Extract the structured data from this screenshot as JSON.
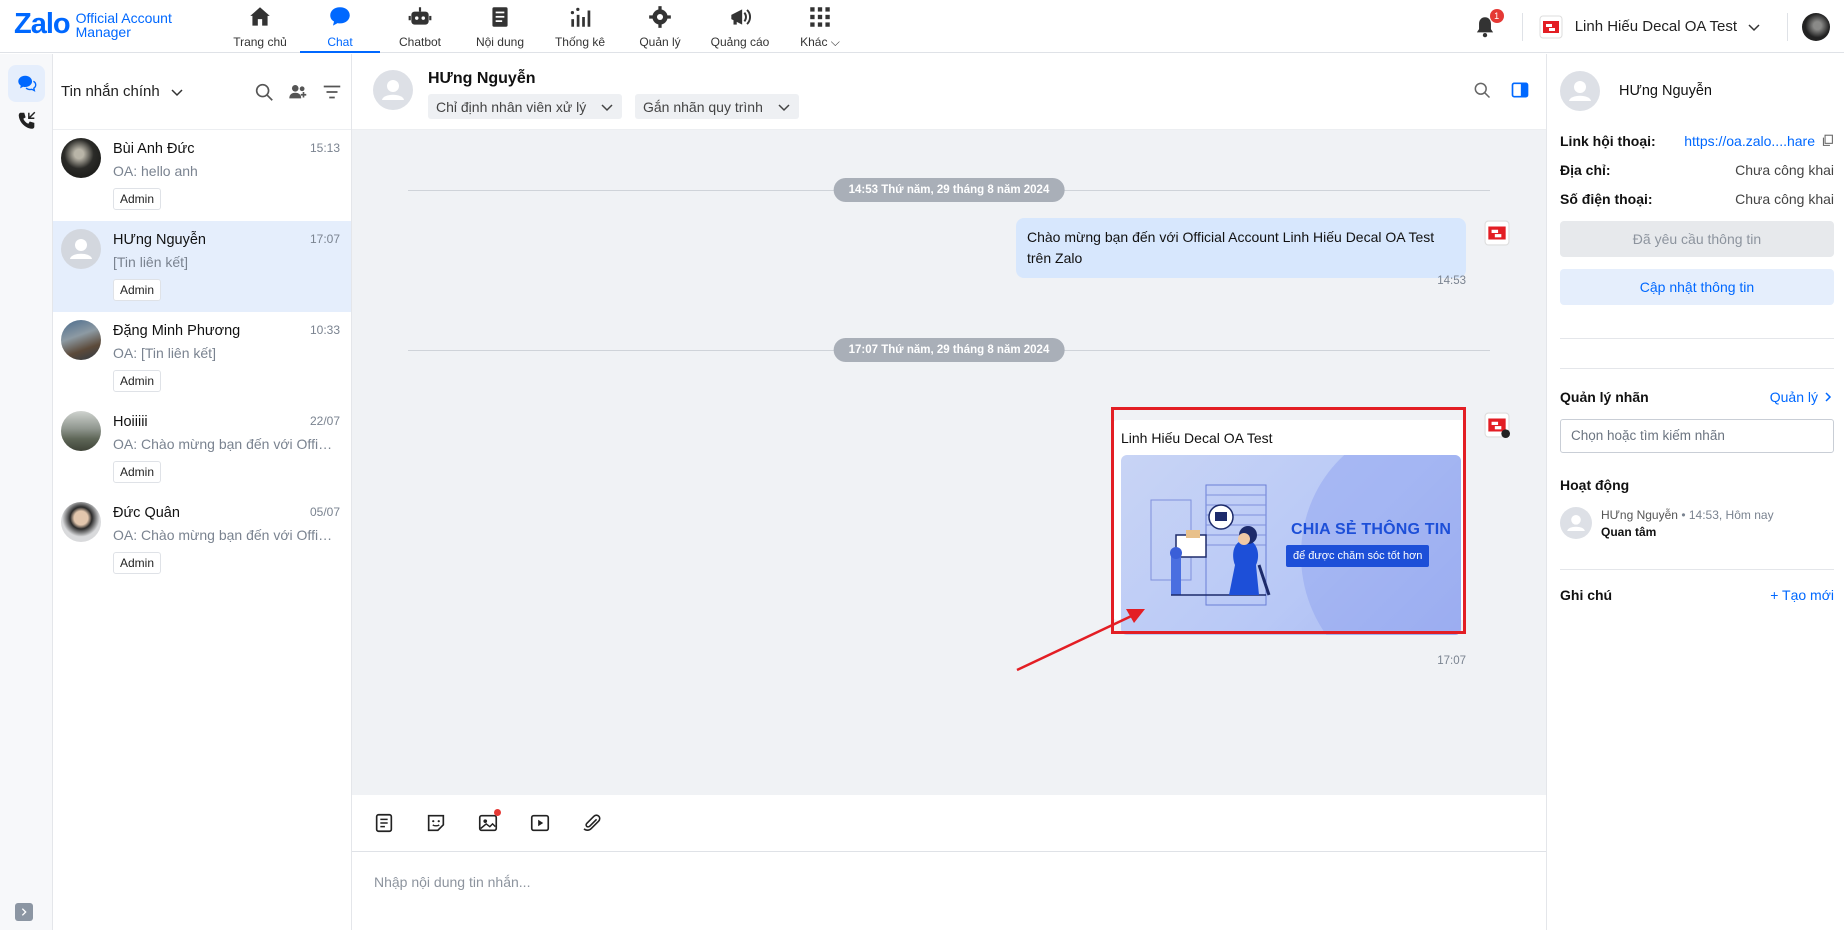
{
  "brand": {
    "logo_main": "Zalo",
    "logo_sub_line1": "Official Account",
    "logo_sub_line2": "Manager",
    "accent": "#0068ff"
  },
  "nav": {
    "items": [
      {
        "label": "Trang chủ",
        "icon": "home-icon"
      },
      {
        "label": "Chat",
        "icon": "chat-icon"
      },
      {
        "label": "Chatbot",
        "icon": "robot-icon"
      },
      {
        "label": "Nội dung",
        "icon": "document-icon"
      },
      {
        "label": "Thống kê",
        "icon": "bar-chart-icon"
      },
      {
        "label": "Quản lý",
        "icon": "gear-icon"
      },
      {
        "label": "Quảng cáo",
        "icon": "megaphone-icon"
      },
      {
        "label": "Khác",
        "icon": "grid-icon"
      }
    ],
    "active": "Chat"
  },
  "header": {
    "notification_count": "1",
    "oa_name": "Linh Hiếu Decal OA Test"
  },
  "conversation_list": {
    "filter_label": "Tin nhắn chính",
    "items": [
      {
        "name": "Bùi Anh Đức",
        "time": "15:13",
        "last": "OA: hello anh",
        "tag": "Admin"
      },
      {
        "name": "HƯng Nguyễn",
        "time": "17:07",
        "last": "[Tin liên kết]",
        "tag": "Admin"
      },
      {
        "name": "Đặng Minh Phương",
        "time": "10:33",
        "last": "OA: [Tin liên kết]",
        "tag": "Admin"
      },
      {
        "name": "Hoiiiii",
        "time": "22/07",
        "last": "OA: Chào mừng bạn đến với Official Account",
        "tag": "Admin"
      },
      {
        "name": "Đức Quân",
        "time": "05/07",
        "last": "OA: Chào mừng bạn đến với Official Account",
        "tag": "Admin"
      }
    ]
  },
  "chat": {
    "contact_name": "HƯng Nguyễn",
    "assign_label": "Chỉ định nhân viên xử lý",
    "tag_label": "Gắn nhãn quy trình",
    "date1": "14:53 Thứ năm, 29 tháng 8 năm 2024",
    "msg1_text": "Chào mừng bạn đến với Official Account Linh Hiếu Decal OA Test trên Zalo",
    "msg1_time": "14:53",
    "date2": "17:07 Thứ năm, 29 tháng 8 năm 2024",
    "card_title": "Linh Hiếu Decal OA Test",
    "card_headline": "CHIA SẺ THÔNG TIN",
    "card_sub": "để được chăm sóc tốt hơn",
    "msg2_time": "17:07",
    "input_placeholder": "Nhập nội dung tin nhắn..."
  },
  "side_panel": {
    "name": "HƯng Nguyễn",
    "link_label": "Link hội thoại:",
    "link_value": "https://oa.zalo....hare",
    "address_label": "Địa chỉ:",
    "address_value": "Chưa công khai",
    "phone_label": "Số điện thoại:",
    "phone_value": "Chưa công khai",
    "requested_btn": "Đã yêu cầu thông tin",
    "update_btn": "Cập nhật thông tin",
    "tags_title": "Quản lý nhãn",
    "tags_link": "Quản lý",
    "tags_placeholder": "Chọn hoặc tìm kiếm nhãn",
    "activity_title": "Hoạt động",
    "activity_actor": "HƯng Nguyễn",
    "activity_time": "14:53, Hôm nay",
    "activity_status": "Quan tâm",
    "notes_title": "Ghi chú",
    "notes_link": "+ Tạo mới"
  }
}
